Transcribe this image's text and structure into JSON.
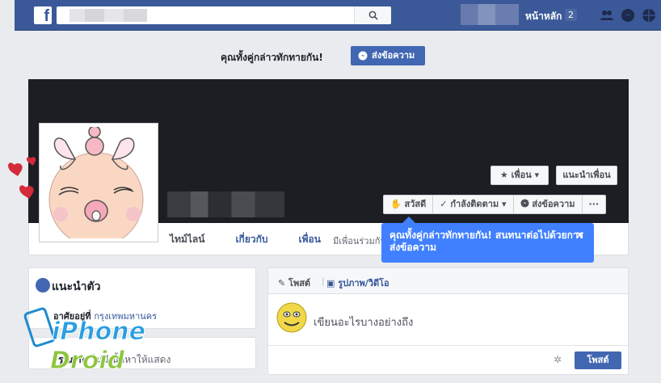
{
  "topbar": {
    "logo": "f",
    "home_label": "หน้าหลัก",
    "home_count": "2",
    "icons": [
      "friends-icon",
      "messenger-icon",
      "globe-icon"
    ],
    "brand_color": "#3b5998"
  },
  "greeting_bar": {
    "text": "คุณทั้งคู่กล่าวทักทายกัน!",
    "send_button": "ส่งข้อความ"
  },
  "cover": {
    "friend_button": "★ เพื่อน ▾",
    "suggest_button": "แนะนำเพื่อน",
    "actions": [
      "สวัสดี",
      "✓ กำลังติดตาม ▾",
      "ส่งข้อความ",
      "···"
    ]
  },
  "tabs": [
    {
      "label": "ไทม์ไลน์",
      "active": true
    },
    {
      "label": "เกี่ยวกับ",
      "active": false
    },
    {
      "label": "เพื่อน",
      "active": false
    }
  ],
  "tab_sub": "มีเพื่อนร่วมกัน",
  "tooltip": {
    "text": "คุณทั้งคู่กล่าวทักทายกัน! สนทนาต่อไปด้วยการส่งข้อความ",
    "close": "×",
    "color": "#4080ff"
  },
  "intro": {
    "title": "แนะนำตัว",
    "lives_label": "อาศัยอยู่ที่",
    "lives_value": "กรุงเทพมหานคร"
  },
  "photos": {
    "label": "รูปภาพ",
    "sub": "ไม่มีเนื้อหาให้แสดง"
  },
  "composer": {
    "post_tab": "โพสต์",
    "photo_tab": "รูปภาพ/วิดีโอ",
    "placeholder": "เขียนอะไรบางอย่างถึง",
    "post_button": "โพสต์"
  },
  "watermark": {
    "line1": "iPhone",
    "line2": "Droid"
  }
}
